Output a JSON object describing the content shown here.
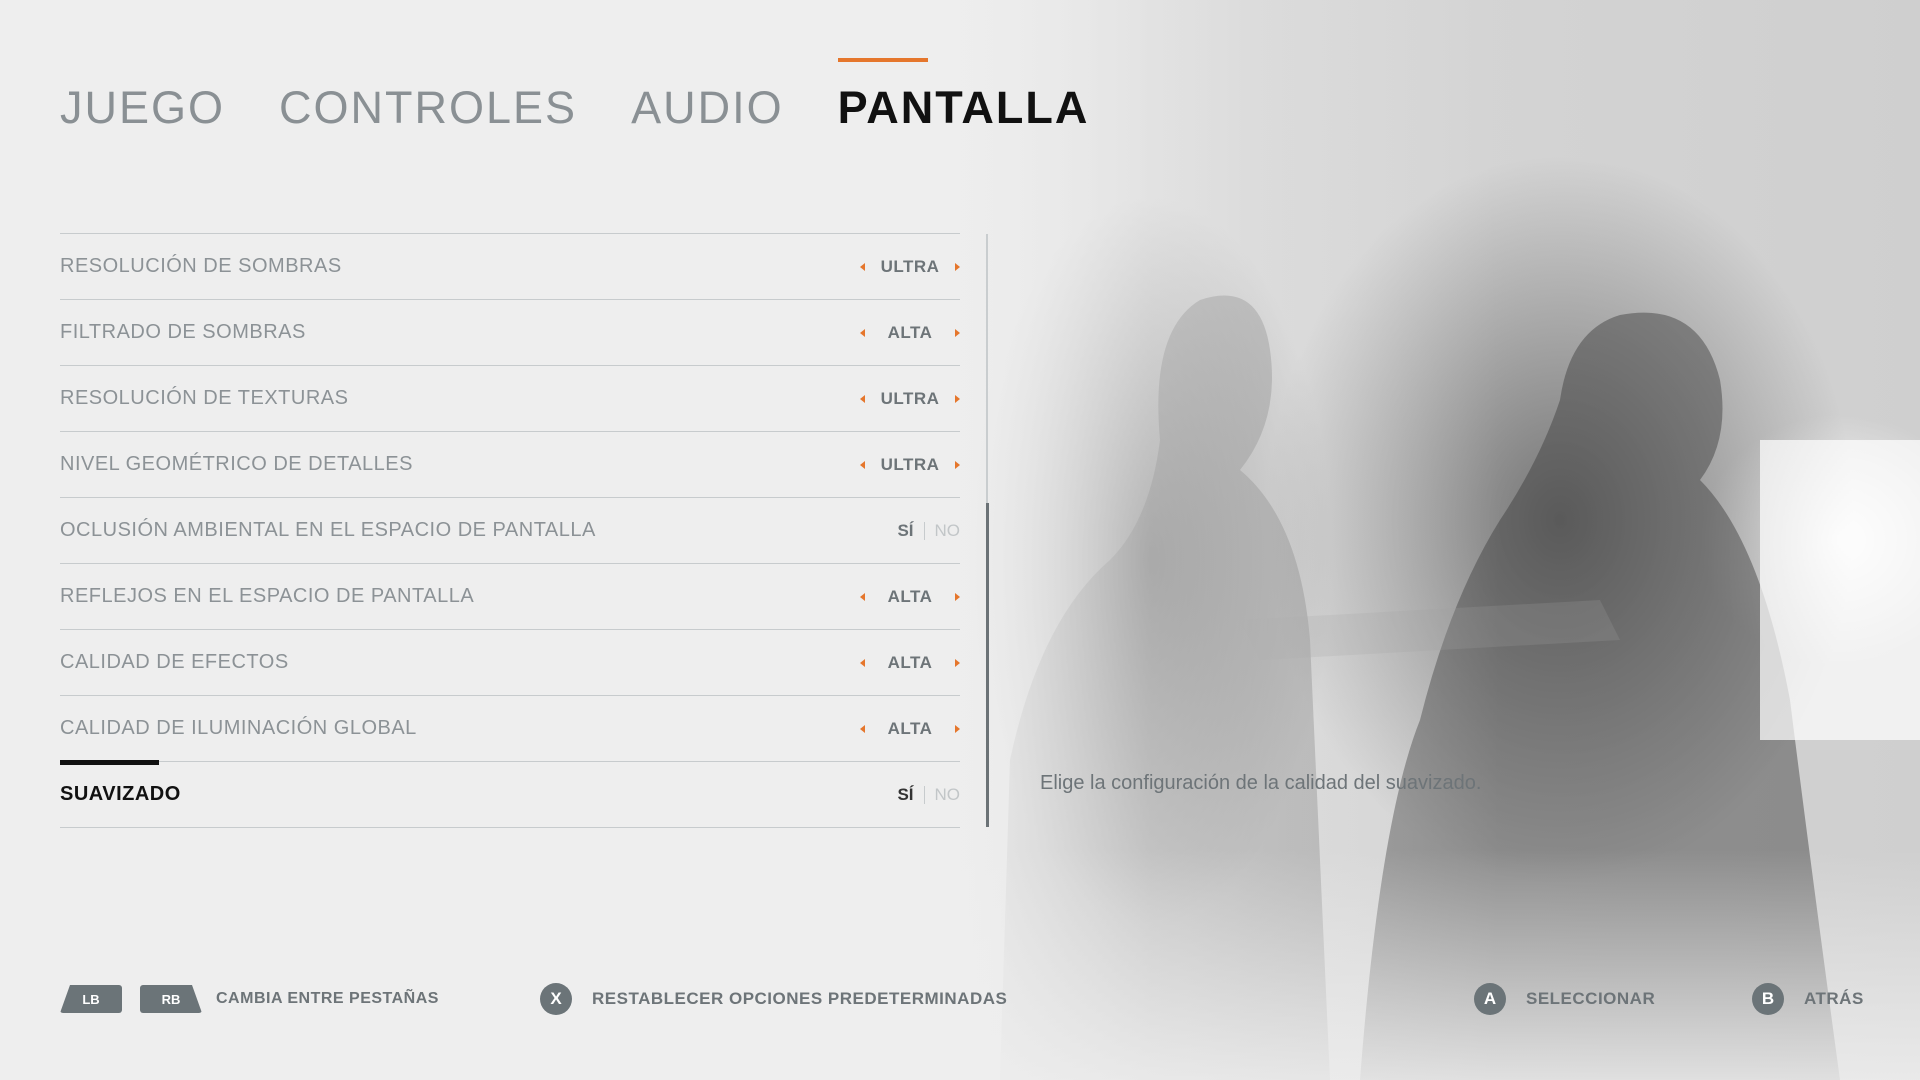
{
  "tabs": [
    {
      "label": "JUEGO",
      "active": false
    },
    {
      "label": "CONTROLES",
      "active": false
    },
    {
      "label": "AUDIO",
      "active": false
    },
    {
      "label": "PANTALLA",
      "active": true
    }
  ],
  "settings": [
    {
      "label": "RESOLUCIÓN DE SOMBRAS",
      "type": "select",
      "value": "ULTRA"
    },
    {
      "label": "FILTRADO DE SOMBRAS",
      "type": "select",
      "value": "ALTA"
    },
    {
      "label": "RESOLUCIÓN DE TEXTURAS",
      "type": "select",
      "value": "ULTRA"
    },
    {
      "label": "NIVEL GEOMÉTRICO DE DETALLES",
      "type": "select",
      "value": "ULTRA"
    },
    {
      "label": "OCLUSIÓN AMBIENTAL EN EL ESPACIO DE PANTALLA",
      "type": "toggle",
      "on_label": "SÍ",
      "off_label": "NO"
    },
    {
      "label": "REFLEJOS EN EL ESPACIO DE PANTALLA",
      "type": "select",
      "value": "ALTA"
    },
    {
      "label": "CALIDAD DE EFECTOS",
      "type": "select",
      "value": "ALTA"
    },
    {
      "label": "CALIDAD DE ILUMINACIÓN GLOBAL",
      "type": "select",
      "value": "ALTA"
    },
    {
      "label": "SUAVIZADO",
      "type": "toggle",
      "on_label": "SÍ",
      "off_label": "NO",
      "selected": true
    }
  ],
  "description": "Elige la configuración de la calidad del suavizado.",
  "footer": {
    "lb": "LB",
    "rb": "RB",
    "switch_tabs": "CAMBIA ENTRE PESTAÑAS",
    "x": "X",
    "reset": "RESTABLECER OPCIONES PREDETERMINADAS",
    "a": "A",
    "select": "SELECCIONAR",
    "b": "B",
    "back": "ATRÁS"
  },
  "colors": {
    "accent": "#e5762c",
    "background": "#eeeeee",
    "text_muted": "#8c9296",
    "text_active": "#111111",
    "button_gray": "#6b7478"
  },
  "icons": [
    "chevron-left-icon",
    "chevron-right-icon",
    "lb-bumper-icon",
    "rb-bumper-icon",
    "x-button-icon",
    "a-button-icon",
    "b-button-icon"
  ]
}
